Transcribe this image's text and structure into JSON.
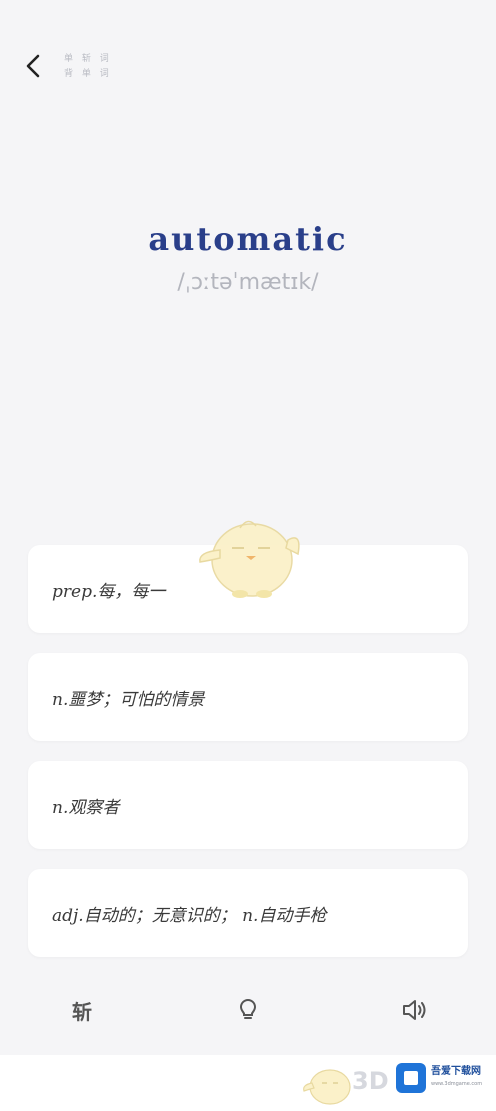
{
  "header": {
    "back_icon": "chevron-left-icon",
    "label_line1": "单 斩 词",
    "label_line2": "背 单 词"
  },
  "word": {
    "text": "automatic",
    "phonetic": "/ˌɔːtəˈmætɪk/"
  },
  "options": [
    {
      "label": "prep.每，每一"
    },
    {
      "label": "n.噩梦；可怕的情景"
    },
    {
      "label": "n.观察者"
    },
    {
      "label": "adj.自动的；无意识的； n.自动手枪"
    }
  ],
  "toolbar": {
    "slash_label": "斩",
    "hint_icon": "lightbulb-icon",
    "sound_icon": "speaker-icon"
  },
  "footer": {
    "brand_3d": "3D",
    "watermark_title": "吾爱下载网",
    "watermark_sub": "www.3dmgame.com"
  },
  "colors": {
    "accent_word": "#2a3f8a",
    "background": "#f5f5f7",
    "card": "#ffffff"
  }
}
